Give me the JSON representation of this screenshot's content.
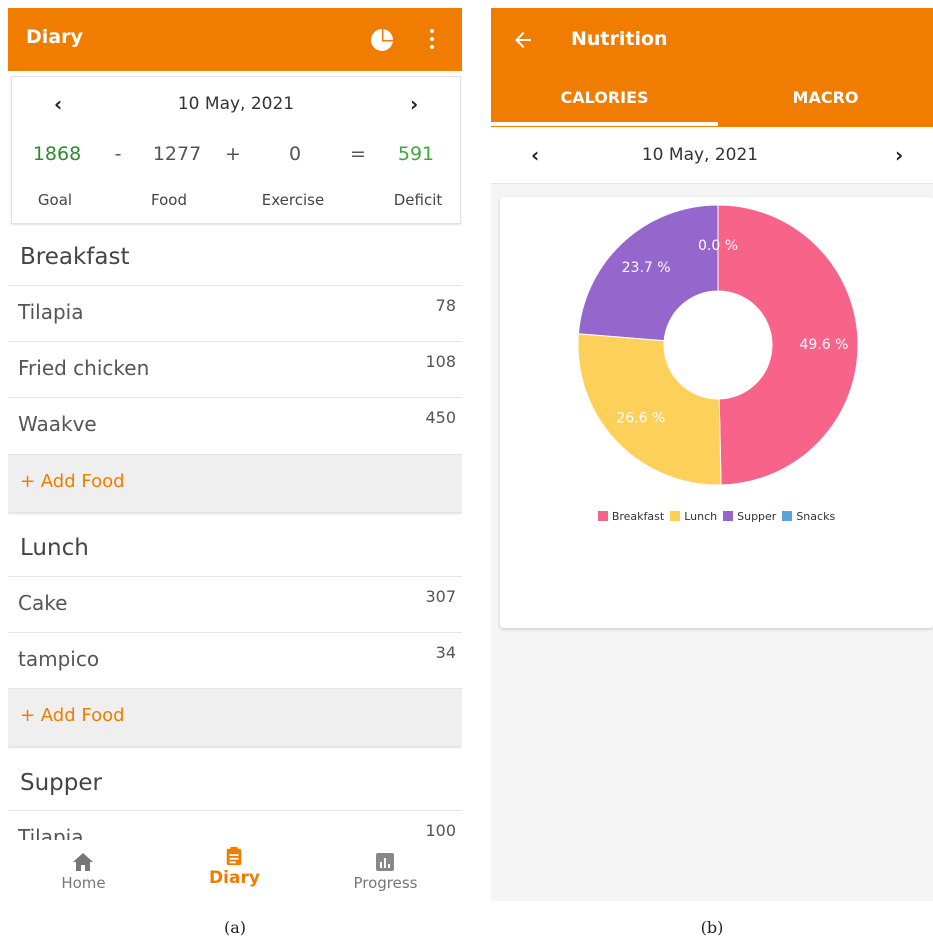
{
  "diary": {
    "title": "Diary",
    "summary": {
      "date": "10 May, 2021",
      "goal": "1868",
      "minus": "-",
      "food": "1277",
      "plus": "+",
      "exercise": "0",
      "equals": "=",
      "deficit": "591",
      "goal_label": "Goal",
      "food_label": "Food",
      "exercise_label": "Exercise",
      "deficit_label": "Deficit"
    },
    "sections": [
      {
        "title": "Breakfast",
        "items": [
          {
            "name": "Tilapia",
            "calories": "78"
          },
          {
            "name": "Fried chicken",
            "calories": "108"
          },
          {
            "name": "Waakve",
            "calories": "450"
          }
        ],
        "add_label": "+ Add Food"
      },
      {
        "title": "Lunch",
        "items": [
          {
            "name": "Cake",
            "calories": "307"
          },
          {
            "name": "tampico",
            "calories": "34"
          }
        ],
        "add_label": "+ Add Food"
      },
      {
        "title": "Supper",
        "items": [
          {
            "name": "Tilapia",
            "calories": "100"
          }
        ]
      }
    ],
    "bottom_nav": [
      {
        "label": "Home",
        "icon": "home-icon"
      },
      {
        "label": "Diary",
        "icon": "clipboard-icon",
        "active": true
      },
      {
        "label": "Progress",
        "icon": "bar-chart-icon"
      }
    ]
  },
  "nutrition": {
    "title": "Nutrition",
    "tabs": [
      {
        "label": "CALORIES",
        "active": true
      },
      {
        "label": "MACRO"
      }
    ],
    "date": "10 May, 2021"
  },
  "chart_data": {
    "type": "pie",
    "donut": true,
    "categories": [
      "Breakfast",
      "Lunch",
      "Supper",
      "Snacks"
    ],
    "values": [
      49.6,
      26.6,
      23.7,
      0.0
    ],
    "labels": [
      "49.6 %",
      "26.6 %",
      "23.7 %",
      "0.0 %"
    ],
    "colors": [
      "#f76389",
      "#fdd05a",
      "#9566cb",
      "#5aa3d8"
    ],
    "legend_position": "bottom"
  },
  "captions": {
    "a": "(a)",
    "b": "(b)"
  },
  "colors": {
    "accent": "#f07c00",
    "goal_green": "#2e8b2e"
  }
}
